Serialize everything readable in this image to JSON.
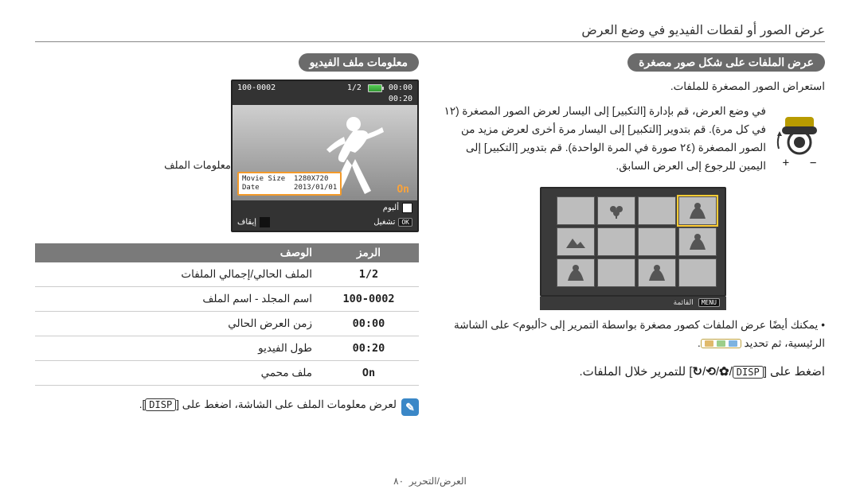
{
  "header": {
    "title": "عرض الصور أو لقطات الفيديو في وضع العرض"
  },
  "right": {
    "heading": "معلومات ملف الفيديو",
    "file_info_label": "معلومات الملف",
    "screen": {
      "frac": "1/2",
      "folder_file": "100-0002",
      "cur_time": "00:00",
      "total_time": "00:20",
      "on": "On",
      "movie_size_label": "Movie Size",
      "movie_size_val": "1280X720",
      "date_label": "Date",
      "date_val": "2013/01/01",
      "album": "ألبوم",
      "ok": "OK",
      "play": "تشغيل",
      "stop": "إيقاف",
      "pause_icon": "■"
    },
    "table": {
      "h_symbol": "الرمز",
      "h_desc": "الوصف",
      "rows": [
        {
          "sym": "1/2",
          "desc": "الملف الحالي/إجمالي الملفات"
        },
        {
          "sym": "100-0002",
          "desc": "اسم المجلد - اسم الملف"
        },
        {
          "sym": "00:00",
          "desc": "زمن العرض الحالي"
        },
        {
          "sym": "00:20",
          "desc": "طول الفيديو"
        },
        {
          "sym": "On",
          "desc": "ملف محمي"
        }
      ]
    },
    "note": "لعرض معلومات الملف على الشاشة، اضغط على",
    "note_btn": "DISP"
  },
  "left": {
    "heading": "عرض الملفات على شكل صور مصغرة",
    "intro": "استعراض الصور المصغرة للملفات.",
    "body": "في وضع العرض، قم بإدارة [التكبير] إلى اليسار لعرض الصور المصغرة (١٢ في كل مرة). قم بتدوير [التكبير] إلى اليسار مرة أخرى لعرض مزيد من الصور المصغرة (٢٤ صورة في المرة الواحدة). قم بتدوير [التكبير] إلى اليمين للرجوع إلى العرض السابق.",
    "menu": "MENU",
    "menu_label": "القائمة",
    "bullet": "يمكنك أيضًا عرض الملفات كصور مصغرة بواسطة التمرير إلى <ألبوم> على الشاشة الرئيسية، ثم تحديد",
    "nav": "اضغط على [DISP/ / / ] للتمرير خلال الملفات.",
    "nav_btn": "DISP"
  },
  "footer": {
    "section": "العرض/التحرير",
    "page": "٨٠"
  }
}
